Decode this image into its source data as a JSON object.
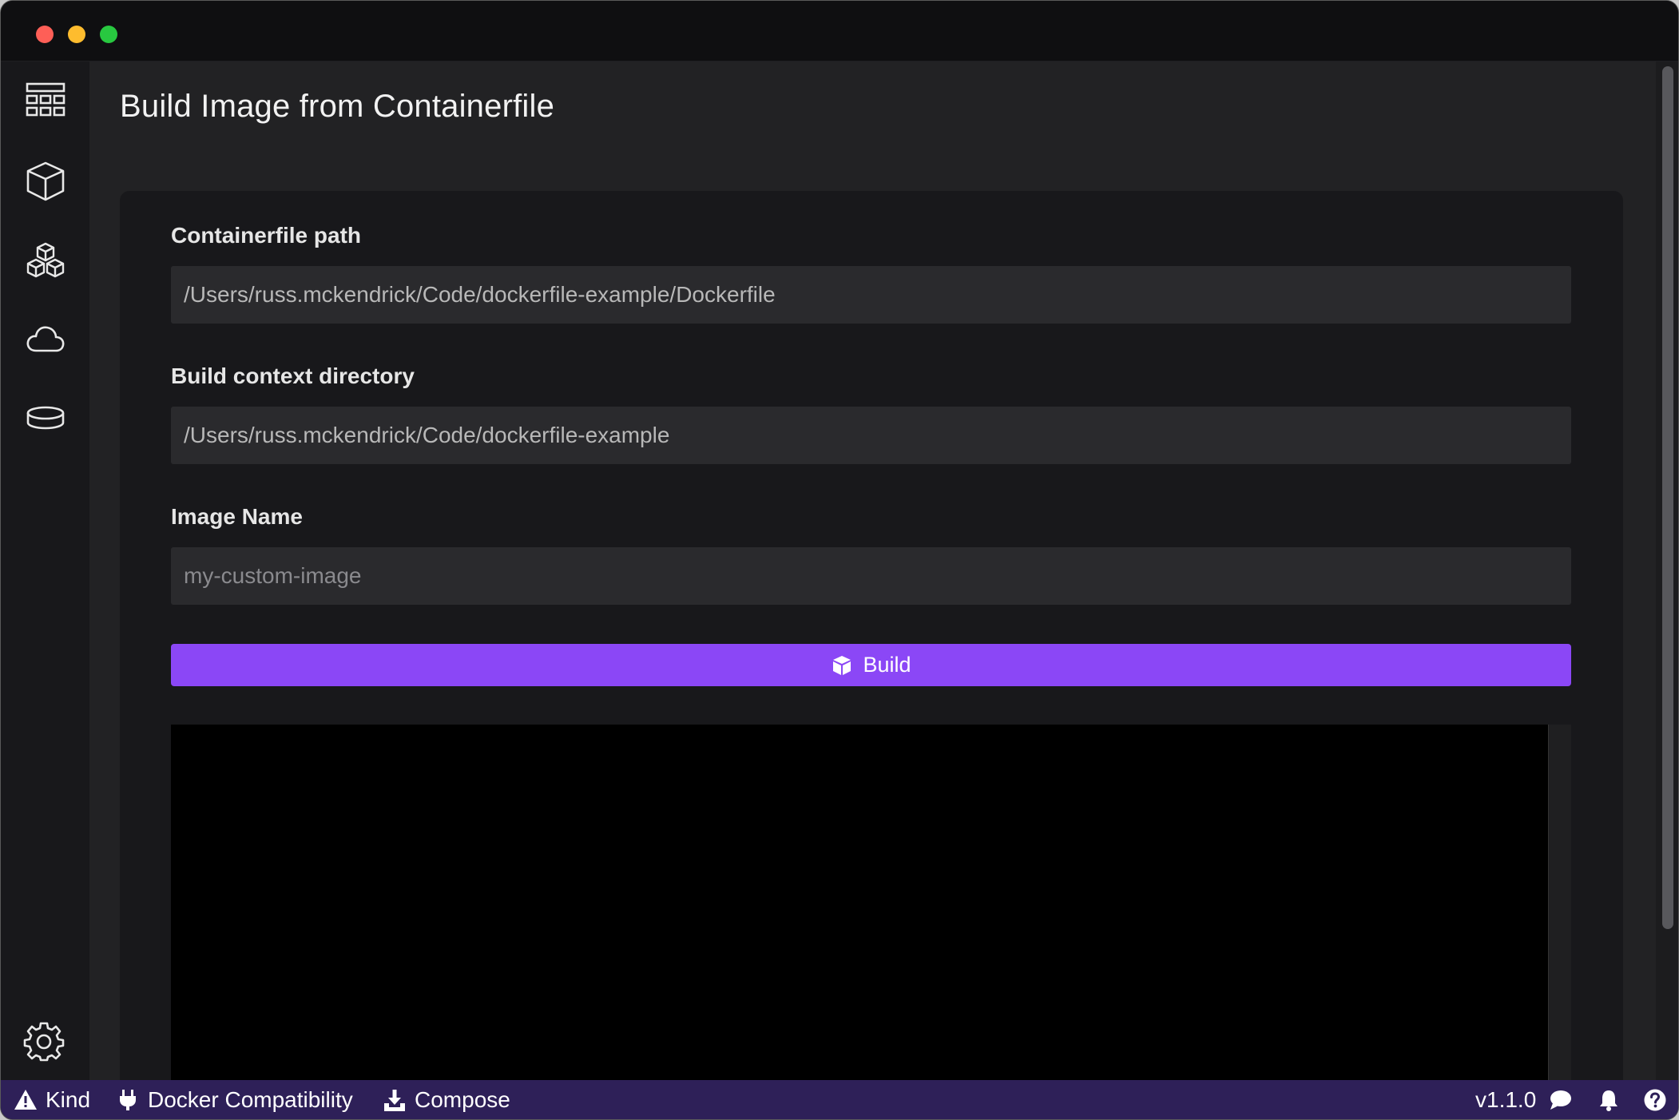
{
  "page": {
    "title": "Build Image from Containerfile"
  },
  "sidebar": {
    "items": [
      {
        "icon": "dashboard-icon"
      },
      {
        "icon": "containers-icon"
      },
      {
        "icon": "images-icon"
      },
      {
        "icon": "cloud-icon"
      },
      {
        "icon": "volumes-icon"
      }
    ],
    "settings_icon": "gear-icon"
  },
  "form": {
    "containerfile_label": "Containerfile path",
    "containerfile_value": "/Users/russ.mckendrick/Code/dockerfile-example/Dockerfile",
    "context_label": "Build context directory",
    "context_value": "/Users/russ.mckendrick/Code/dockerfile-example",
    "image_name_label": "Image Name",
    "image_name_placeholder": "my-custom-image",
    "image_name_value": "",
    "build_label": "Build"
  },
  "statusbar": {
    "kind_label": "Kind",
    "docker_compat_label": "Docker Compatibility",
    "compose_label": "Compose",
    "version": "v1.1.0"
  },
  "colors": {
    "accent": "#8b47f6",
    "statusbar": "#2e2058",
    "background": "#222224",
    "card": "#18181b"
  }
}
